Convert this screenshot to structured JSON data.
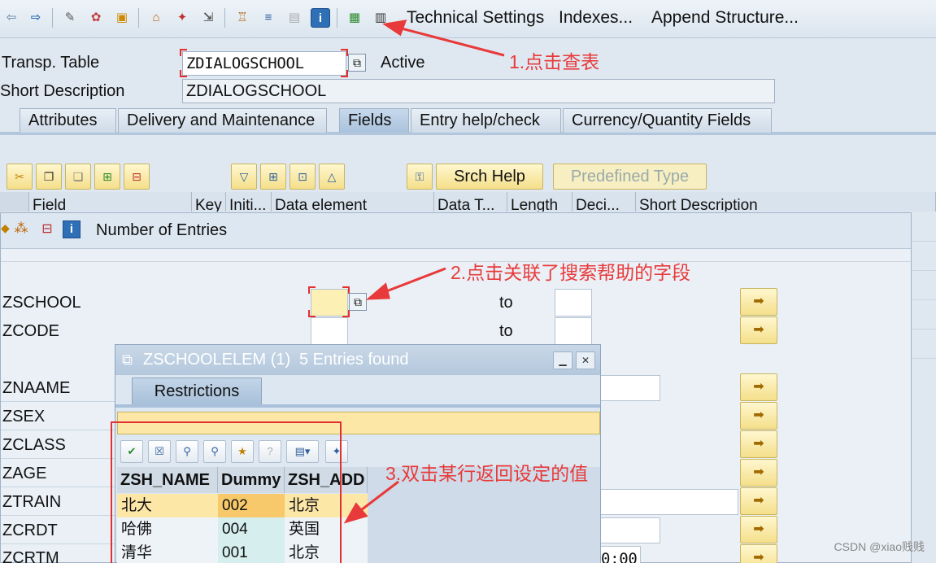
{
  "toolbar": {
    "technical_settings": "Technical Settings",
    "indexes": "Indexes...",
    "append_structure": "Append Structure..."
  },
  "header": {
    "transp_table_label": "Transp. Table",
    "table_name": "ZDIALOGSCHOOL",
    "status": "Active",
    "short_description_label": "Short Description",
    "short_description": "ZDIALOGSCHOOL"
  },
  "tabs": [
    {
      "label": "Attributes"
    },
    {
      "label": "Delivery and Maintenance"
    },
    {
      "label": "Fields"
    },
    {
      "label": "Entry help/check"
    },
    {
      "label": "Currency/Quantity Fields"
    }
  ],
  "fields_toolbar": {
    "srch_help": "Srch Help",
    "predefined_type": "Predefined Type"
  },
  "columns": [
    "Field",
    "Key",
    "Initi...",
    "Data element",
    "Data T...",
    "Length",
    "Deci...",
    "Short Description"
  ],
  "number_dialog": {
    "title": "Number of Entries",
    "to_label": "to",
    "fields": [
      "ZSCHOOL",
      "ZCODE",
      "ZNAAME",
      "ZSEX",
      "ZCLASS",
      "ZAGE",
      "ZTRAIN",
      "ZCRDT",
      "ZCRTM"
    ],
    "time_fragment": "0:00"
  },
  "popup": {
    "title": "ZSCHOOLELEM (1)",
    "entries_found": "5 Entries found",
    "restrictions_tab": "Restrictions",
    "columns": [
      "ZSH_NAME",
      "Dummy",
      "ZSH_ADD"
    ],
    "rows": [
      {
        "name": "北大",
        "dummy": "002",
        "add": "北京"
      },
      {
        "name": "哈佛",
        "dummy": "004",
        "add": "英国"
      },
      {
        "name": "清华",
        "dummy": "001",
        "add": "北京"
      }
    ]
  },
  "annotations": {
    "step1": "1.点击查表",
    "step2": "2.点击关联了搜索帮助的字段",
    "step3": "3.双击某行返回设定的值"
  },
  "watermark": "CSDN @xiao贱贱",
  "colors": {
    "annotation_red": "#e83a3a",
    "button_yellow": "#f4df8a",
    "selected_row": "#fde7a7",
    "dummy_column": "#d6efee"
  }
}
